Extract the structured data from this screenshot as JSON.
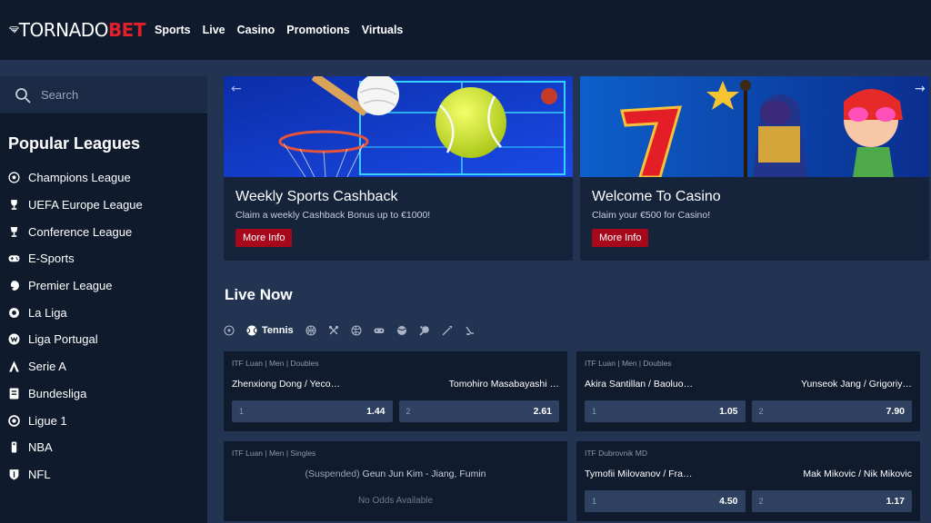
{
  "brand": {
    "name_part1": "TORNADO",
    "name_part2": "BET"
  },
  "nav": [
    "Sports",
    "Live",
    "Casino",
    "Promotions",
    "Virtuals"
  ],
  "search": {
    "placeholder": "Search"
  },
  "sidebar": {
    "title": "Popular Leagues",
    "items": [
      {
        "label": "Champions League",
        "icon": "soccer-ball-icon"
      },
      {
        "label": "UEFA Europe League",
        "icon": "europa-trophy-icon"
      },
      {
        "label": "Conference League",
        "icon": "conference-trophy-icon"
      },
      {
        "label": "E-Sports",
        "icon": "gamepad-icon"
      },
      {
        "label": "Premier League",
        "icon": "lion-crest-icon"
      },
      {
        "label": "La Liga",
        "icon": "laliga-icon"
      },
      {
        "label": "Liga Portugal",
        "icon": "liga-portugal-icon"
      },
      {
        "label": "Serie A",
        "icon": "serie-a-icon"
      },
      {
        "label": "Bundesliga",
        "icon": "bundesliga-icon"
      },
      {
        "label": "Ligue 1",
        "icon": "ligue1-icon"
      },
      {
        "label": "NBA",
        "icon": "nba-icon"
      },
      {
        "label": "NFL",
        "icon": "nfl-shield-icon"
      }
    ]
  },
  "promos": [
    {
      "title": "Weekly Sports Cashback",
      "subtitle": "Claim a weekly Cashback Bonus up to €1000!",
      "button": "More Info"
    },
    {
      "title": "Welcome To Casino",
      "subtitle": "Claim your €500 for Casino!",
      "button": "More Info"
    }
  ],
  "live": {
    "title": "Live Now",
    "active_tab": "Tennis",
    "tabs": [
      "soccer-icon",
      "tennis-icon",
      "basketball-icon",
      "badminton-icon",
      "volleyball-icon",
      "esports-icon",
      "ball-icon",
      "table-tennis-icon",
      "darts-icon",
      "hockey-icon"
    ],
    "matches": [
      {
        "meta": "ITF Luan | Men | Doubles",
        "home": "Zhenxiong Dong / Yeco…",
        "away": "Tomohiro Masabayashi …",
        "odds": [
          {
            "k": "1",
            "v": "1.44"
          },
          {
            "k": "2",
            "v": "2.61"
          }
        ]
      },
      {
        "meta": "ITF Luan | Men | Doubles",
        "home": "Akira Santillan / Baoluo…",
        "away": "Yunseok Jang / Grigoriy…",
        "odds": [
          {
            "k": "1",
            "v": "1.05"
          },
          {
            "k": "2",
            "v": "7.90"
          }
        ]
      },
      {
        "meta": "ITF Luan | Men | Singles",
        "suspended_tag": "(Suspended)",
        "suspended_teams": "Geun Jun Kim - Jiang, Fumin",
        "no_odds": "No Odds Available"
      },
      {
        "meta": "ITF Dubrovnik MD",
        "home": "Tymofii Milovanov / Fra…",
        "away": "Mak Mikovic / Nik Mikovic",
        "odds": [
          {
            "k": "1",
            "v": "4.50"
          },
          {
            "k": "2",
            "v": "1.17"
          }
        ]
      }
    ]
  },
  "colors": {
    "accent": "#a8081c",
    "brand_red": "#e0202a",
    "header_bg": "#0f1a2c",
    "page_bg": "#233453"
  }
}
